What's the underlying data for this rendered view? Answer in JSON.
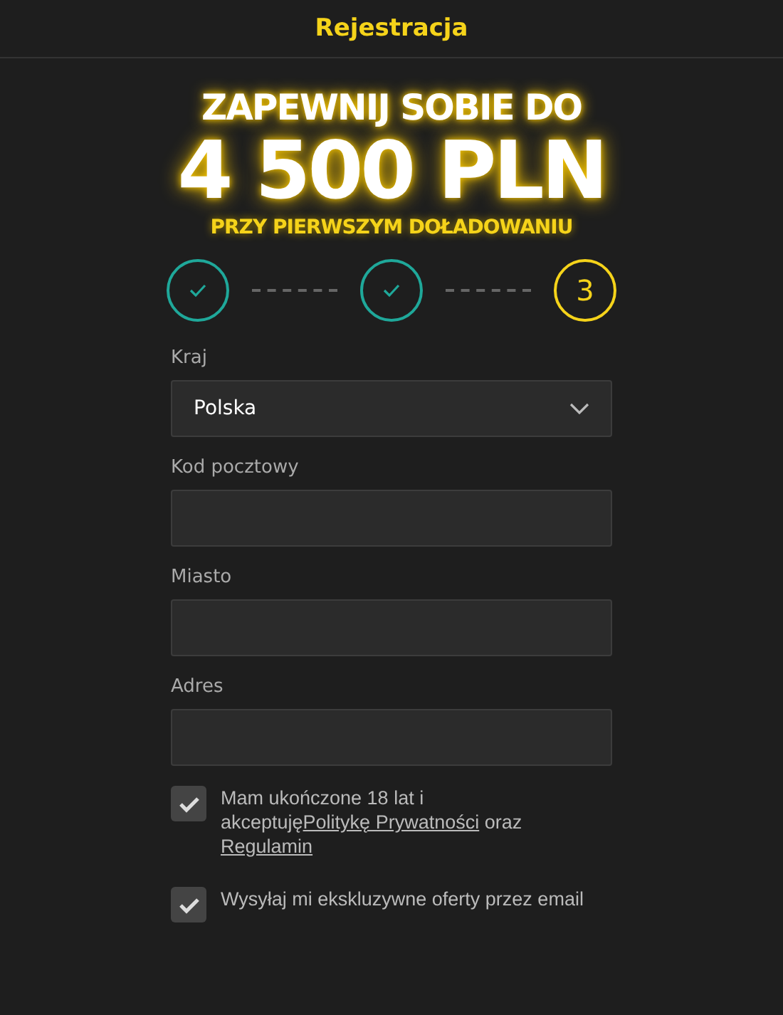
{
  "header": {
    "title": "Rejestracja"
  },
  "promo": {
    "line_1": "ZAPEWNIJ SOBIE DO",
    "amount": "4 500 PLN",
    "line_2": "PRZY PIERWSZYM DOŁADOWANIU"
  },
  "steps": [
    {
      "completed": true
    },
    {
      "completed": true
    },
    {
      "completed": false,
      "label": "3"
    }
  ],
  "fields": [
    {
      "kind": "select",
      "label": "Kraj",
      "value": "Polska"
    },
    {
      "kind": "text",
      "label": "Kod pocztowy"
    },
    {
      "kind": "text",
      "label": "Miasto"
    },
    {
      "kind": "text",
      "label": "Adres"
    }
  ],
  "consents": [
    {
      "checked": true,
      "text": "Mam ukończone 18 lat i akceptuję",
      "links": [
        {
          "text": "Politykę Prywatności",
          "after": "oraz"
        },
        {
          "text": "Regulamin"
        }
      ]
    },
    {
      "checked": true,
      "text": "Wysyłaj mi ekskluzywne oferty przez email"
    }
  ]
}
